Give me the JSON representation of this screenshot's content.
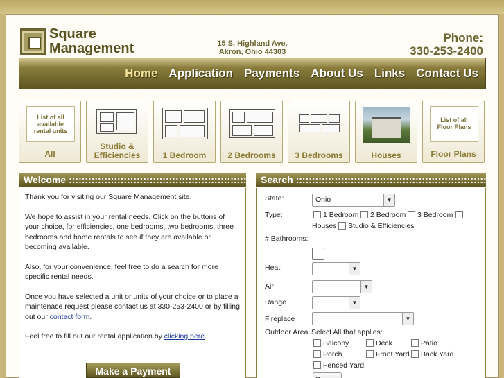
{
  "header": {
    "logo_line1": "Square",
    "logo_line2": "Management",
    "address_line1": "15 S. Highland Ave.",
    "address_line2": "Akron, Ohio 44303",
    "phone_label": "Phone:",
    "phone_number": "330-253-2400"
  },
  "nav": [
    "Home",
    "Application",
    "Payments",
    "About Us",
    "Links",
    "Contact Us"
  ],
  "categories": [
    {
      "label": "All",
      "thumb_text": "List of all available rental units"
    },
    {
      "label": "Studio & Efficiencies"
    },
    {
      "label": "1 Bedroom"
    },
    {
      "label": "2 Bedrooms"
    },
    {
      "label": "3 Bedrooms"
    },
    {
      "label": "Houses"
    },
    {
      "label": "Floor Plans",
      "thumb_text": "List of all Floor Plans"
    }
  ],
  "welcome": {
    "title": "Welcome ::::::::::::::::::::::::::::::::::::::::::::::::::::::::::",
    "p1": "Thank you for visiting our Square Management site.",
    "p2": "We hope to assist in your rental needs. Click on the buttons of your choice, for efficiencies, one bedrooms, two bedrooms, three bedrooms and home rentals to see if they are available or becoming available.",
    "p3": "Also, for your convenience, feel free to do a search for more specific rental needs.",
    "p4_before": "Once you have selected a unit or units of your choice or to place a maintenace request please contact us at 330-253-2400 or by filling out our ",
    "p4_link": "contact form",
    "p4_after": ".",
    "p5_before": "Feel free to fill out our rental application by ",
    "p5_link": "clicking here",
    "p5_after": ".",
    "payment_button": "Make a Payment"
  },
  "search": {
    "title": "Search ::::::::::::::::::::::::::::::::::::::::::::::::::::::::::::::",
    "state_label": "State:",
    "state_value": "Ohio",
    "type_label": "Type:",
    "types": [
      "1 Bedroom",
      "2 Bedroom",
      "3 Bedroom",
      "Houses",
      "Studio & Efficiencies"
    ],
    "bathrooms_label": "# Bathrooms:",
    "heat_label": "Heat:",
    "air_label": "Air",
    "range_label": "Range",
    "fireplace_label": "Fireplace",
    "outdoor_label": "Outdoor Area",
    "outdoor_hint": "Select All that applies:",
    "outdoor": [
      "Balcony",
      "Deck",
      "Patio",
      "Porch",
      "Front Yard",
      "Back Yard",
      "Fenced Yard"
    ],
    "search_button": "Search"
  }
}
